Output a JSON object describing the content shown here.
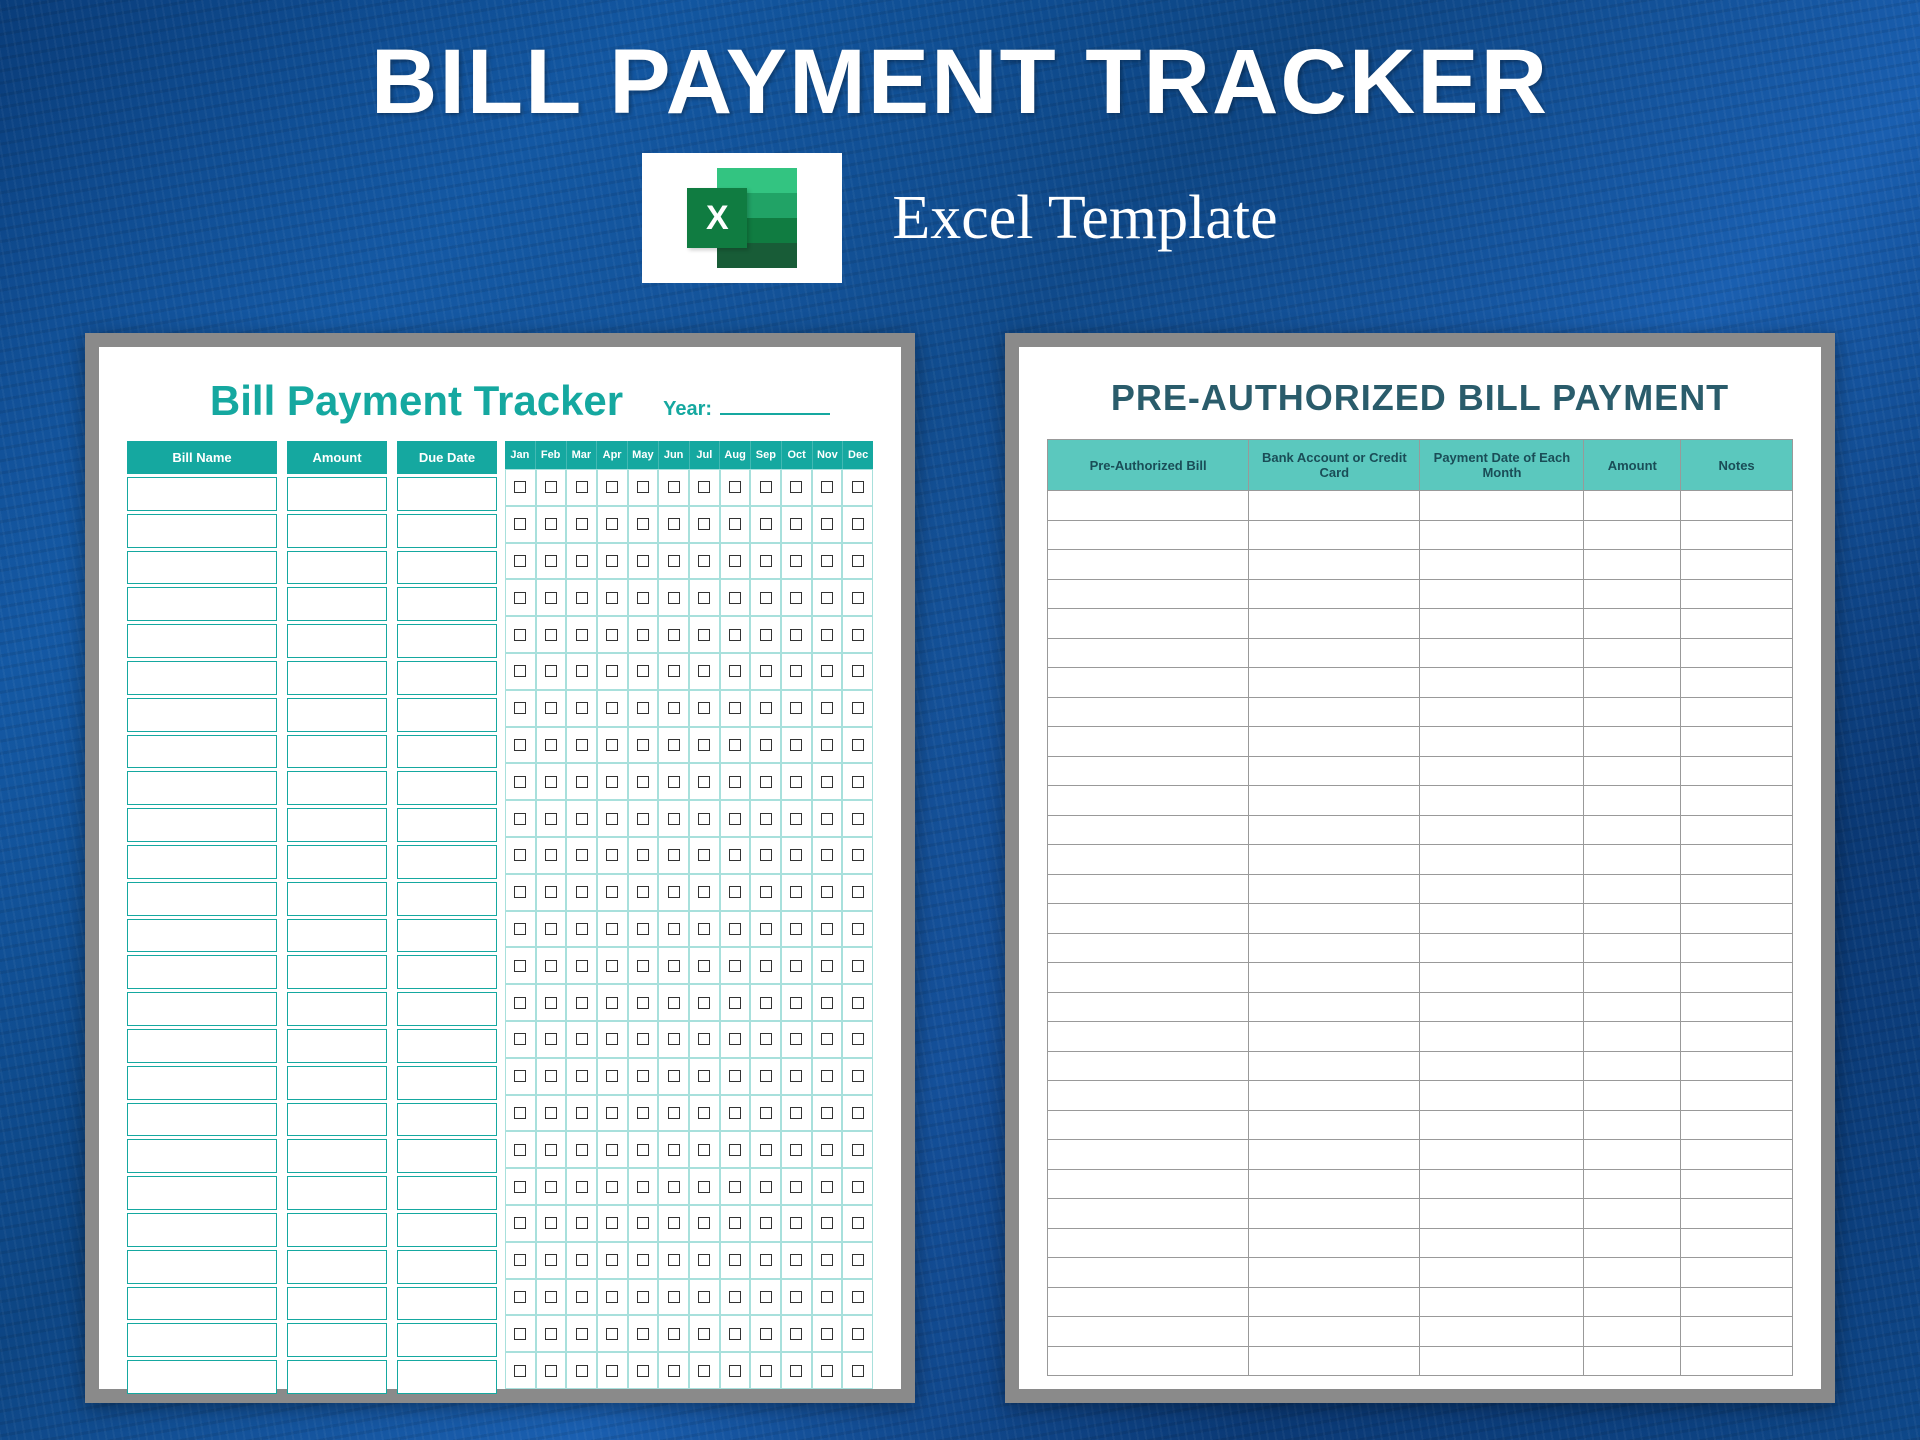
{
  "header": {
    "title": "BILL PAYMENT TRACKER",
    "subtitle": "Excel Template",
    "icon_letter": "X"
  },
  "sheet1": {
    "title": "Bill Payment Tracker",
    "year_label": "Year:",
    "columns": {
      "bill_name": "Bill Name",
      "amount": "Amount",
      "due_date": "Due Date"
    },
    "months": [
      "Jan",
      "Feb",
      "Mar",
      "Apr",
      "May",
      "Jun",
      "Jul",
      "Aug",
      "Sep",
      "Oct",
      "Nov",
      "Dec"
    ],
    "row_count": 25
  },
  "sheet2": {
    "title": "PRE-AUTHORIZED BILL PAYMENT",
    "columns": {
      "bill": "Pre-Authorized Bill",
      "bank": "Bank Account or Credit Card",
      "date": "Payment Date of Each Month",
      "amount": "Amount",
      "notes": "Notes"
    },
    "row_count": 30
  },
  "colors": {
    "teal": "#15a8a0",
    "teal_light": "#5bc8be",
    "title_dark": "#2a5c6b"
  }
}
